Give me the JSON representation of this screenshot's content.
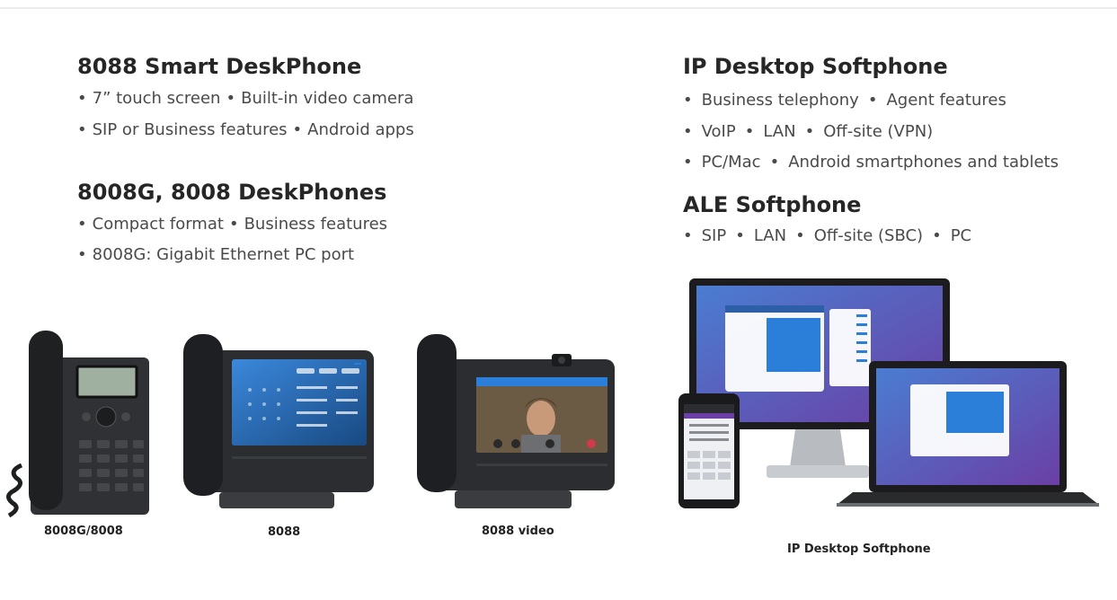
{
  "left": {
    "sections": [
      {
        "title": "8088 Smart DeskPhone",
        "lines": [
          [
            "7” touch screen",
            "Built-in video camera"
          ],
          [
            "SIP or Business features",
            "Android apps"
          ]
        ]
      },
      {
        "title": "8008G, 8008 DeskPhones",
        "lines": [
          [
            "Compact format",
            "Business features"
          ],
          [
            "8008G: Gigabit Ethernet PC port"
          ]
        ]
      }
    ],
    "captions": [
      "8008G/8008",
      "8088",
      "8088 video"
    ]
  },
  "right": {
    "sections": [
      {
        "title": "IP Desktop Softphone",
        "lines": [
          [
            "Business telephony",
            "Agent features"
          ],
          [
            "VoIP",
            "LAN",
            "Off-site (VPN)"
          ],
          [
            "PC/Mac",
            "Android smartphones and tablets"
          ]
        ]
      },
      {
        "title": "ALE Softphone",
        "lines": [
          [
            "SIP",
            "LAN",
            "Off-site (SBC)",
            "PC"
          ]
        ]
      }
    ],
    "caption": "IP Desktop Softphone"
  },
  "bullet": "•",
  "colors": {
    "accent_blue": "#2c7fd9",
    "device_dark": "#2b2d30",
    "screen_purple": "#5b3fa0"
  }
}
